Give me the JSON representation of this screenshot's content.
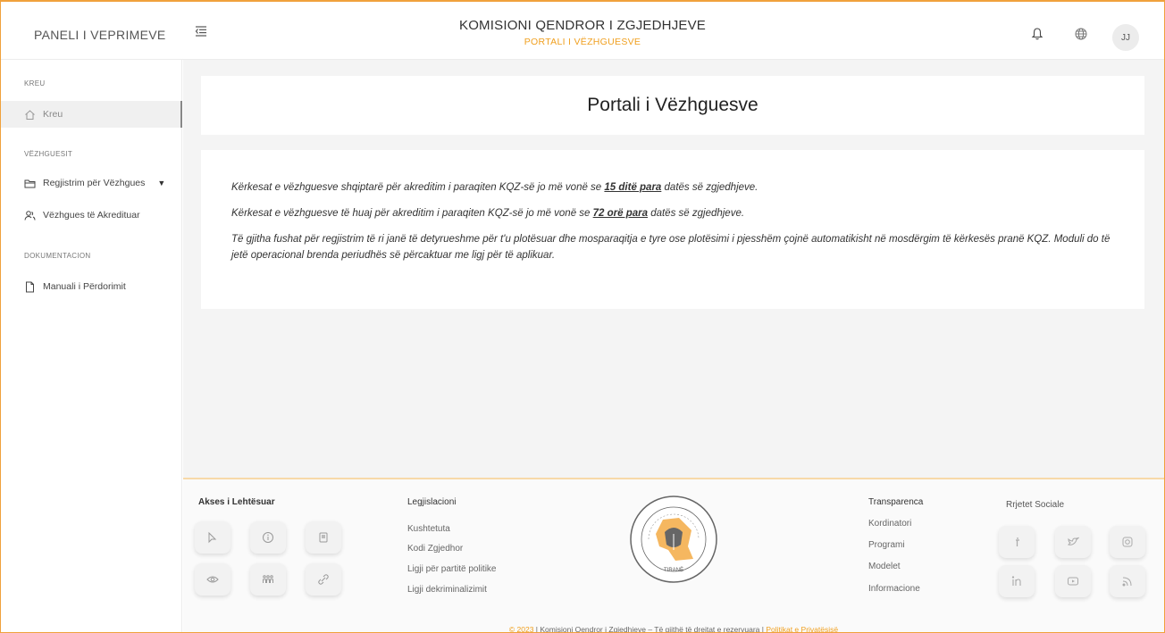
{
  "header": {
    "brand": "PANELI I VEPRIMEVE",
    "title": "KOMISIONI QENDROR I ZGJEDHJEVE",
    "subtitle": "PORTALI I VËZHGUESVE",
    "avatar_initials": "JJ",
    "icons": [
      "menu-toggle-icon",
      "bell-icon",
      "globe-icon"
    ]
  },
  "sidebar": {
    "sections": [
      {
        "label": "KREU",
        "items": [
          {
            "label": "Kreu",
            "icon": "home-icon",
            "active": true
          }
        ]
      },
      {
        "label": "VËZHGUESIT",
        "items": [
          {
            "label": "Regjistrim për Vëzhgues",
            "icon": "folder-icon",
            "expandable": true
          },
          {
            "label": "Vëzhgues të Akredituar",
            "icon": "users-icon"
          }
        ]
      },
      {
        "label": "DOKUMENTACION",
        "items": [
          {
            "label": "Manuali i Përdorimit",
            "icon": "document-icon"
          }
        ]
      }
    ]
  },
  "main": {
    "page_title": "Portali i Vëzhguesve",
    "info": {
      "p1_before": "Kërkesat e vëzhguesve shqiptarë për akreditim i paraqiten KQZ-së jo më vonë se ",
      "p1_bold": "15 ditë para",
      "p1_after": " datës së zgjedhjeve.",
      "p2_before": "Kërkesat e vëzhguesve të huaj për akreditim i paraqiten KQZ-së jo më vonë se ",
      "p2_bold": "72 orë para",
      "p2_after": " datës së zgjedhjeve.",
      "p3": "Të gjitha fushat për regjistrim të ri janë të detyrueshme për t'u plotësuar dhe mosparaqitja e tyre ose plotësimi i pjesshëm çojnë automatikisht në mosdërgim të kërkesës pranë KQZ. Moduli do të jetë operacional brenda periudhës së përcaktuar me ligj për të aplikuar."
    }
  },
  "footer": {
    "accessibility": {
      "heading": "Akses i Lehtësuar",
      "buttons": [
        "cursor-icon",
        "info-icon",
        "contrast-icon",
        "eye-icon",
        "people-icon",
        "link-icon"
      ]
    },
    "legislation": {
      "heading": "Legjislacioni",
      "links": [
        "Kushtetuta",
        "Kodi Zgjedhor",
        "Ligji për partitë politike",
        "Ligji dekriminalizimit"
      ]
    },
    "seal": {
      "ring_text": "KOMISIONI QENDROR I ZGJEDHJEVE",
      "city": "TIRANË"
    },
    "transparency": {
      "heading": "Transparenca",
      "links": [
        "Kordinatori",
        "Programi",
        "Modelet",
        "Informacione"
      ]
    },
    "social": {
      "heading": "Rrjetet Sociale",
      "icons": [
        "facebook-icon",
        "twitter-icon",
        "instagram-icon",
        "linkedin-icon",
        "youtube-icon",
        "rss-icon"
      ]
    },
    "copyright": {
      "year": "© 2023",
      "sep1": " | ",
      "text": "Komisioni Qendror i Zgjedhjeve – Të gjithë të drejtat e rezervuara",
      "sep2": " | ",
      "privacy": "Politikat e Privatësisë"
    }
  },
  "colors": {
    "accent": "#f0a020",
    "border": "#f0a13c",
    "background": "#f4f4f4"
  }
}
